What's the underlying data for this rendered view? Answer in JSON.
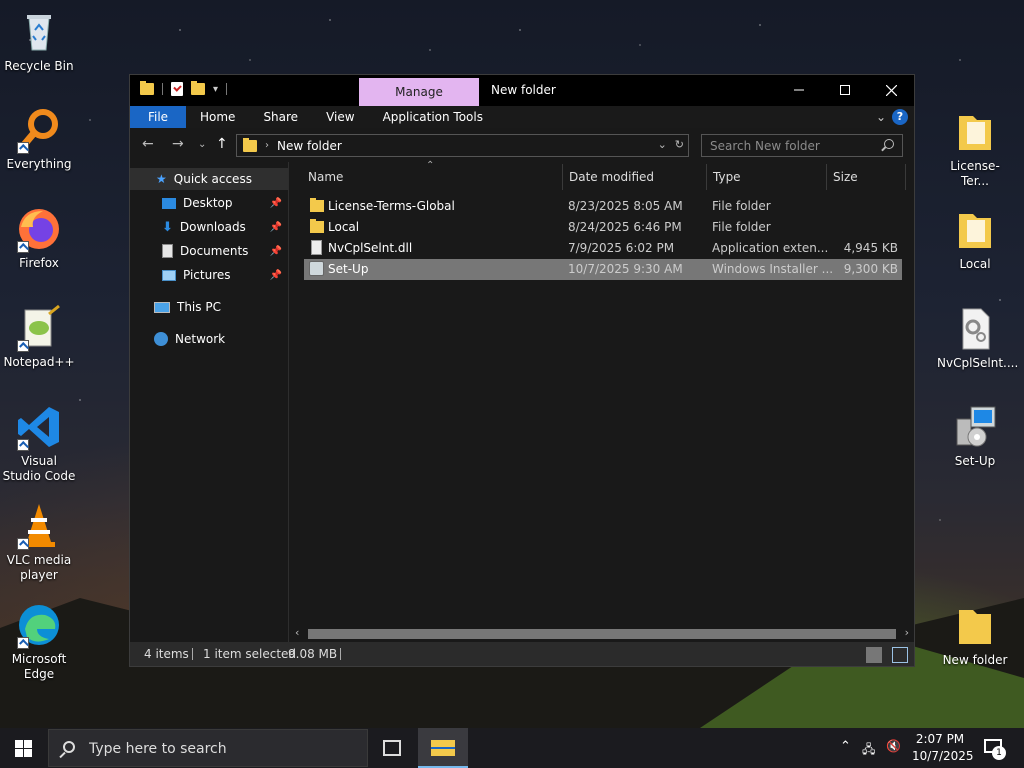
{
  "desktop": {
    "left_icons": [
      {
        "label": "Recycle Bin",
        "icon": "recycle-bin-icon"
      },
      {
        "label": "Everything",
        "icon": "everything-search-icon"
      },
      {
        "label": "Firefox",
        "icon": "firefox-icon"
      },
      {
        "label": "Notepad++",
        "icon": "notepadpp-icon"
      },
      {
        "label": "Visual Studio Code",
        "icon": "vscode-icon"
      },
      {
        "label": "VLC media player",
        "icon": "vlc-icon"
      },
      {
        "label": "Microsoft Edge",
        "icon": "edge-icon"
      }
    ],
    "right_icons": [
      {
        "label": "License-Ter...",
        "icon": "folder-icon"
      },
      {
        "label": "Local",
        "icon": "folder-icon"
      },
      {
        "label": "NvCplSelnt....",
        "icon": "dll-file-icon"
      },
      {
        "label": "Set-Up",
        "icon": "installer-icon"
      },
      {
        "label": "New folder",
        "icon": "folder-icon"
      }
    ]
  },
  "explorer": {
    "title": "New folder",
    "contextual_tab": "Manage",
    "ribbon_tabs": [
      "File",
      "Home",
      "Share",
      "View",
      "Application Tools"
    ],
    "address": {
      "path": "New folder"
    },
    "search_placeholder": "Search New folder",
    "nav_pane": {
      "quick_access": "Quick access",
      "items": [
        "Desktop",
        "Downloads",
        "Documents",
        "Pictures"
      ],
      "this_pc": "This PC",
      "network": "Network"
    },
    "columns": {
      "name": "Name",
      "date": "Date modified",
      "type": "Type",
      "size": "Size"
    },
    "files": [
      {
        "name": "License-Terms-Global",
        "date": "8/23/2025 8:05 AM",
        "type": "File folder",
        "size": "",
        "kind": "folder"
      },
      {
        "name": "Local",
        "date": "8/24/2025 6:46 PM",
        "type": "File folder",
        "size": "",
        "kind": "folder"
      },
      {
        "name": "NvCplSelnt.dll",
        "date": "7/9/2025 6:02 PM",
        "type": "Application exten...",
        "size": "4,945 KB",
        "kind": "dll"
      },
      {
        "name": "Set-Up",
        "date": "10/7/2025 9:30 AM",
        "type": "Windows Installer ...",
        "size": "9,300 KB",
        "kind": "msi",
        "selected": true
      }
    ],
    "status": {
      "items": "4 items",
      "selected": "1 item selected",
      "size": "9.08 MB"
    }
  },
  "taskbar": {
    "search_placeholder": "Type here to search",
    "time": "2:07 PM",
    "date": "10/7/2025",
    "notification_count": "1"
  },
  "colors": {
    "accent": "#1a66c5",
    "manage_tab": "#e3b5f0",
    "folder": "#f3c94b"
  }
}
